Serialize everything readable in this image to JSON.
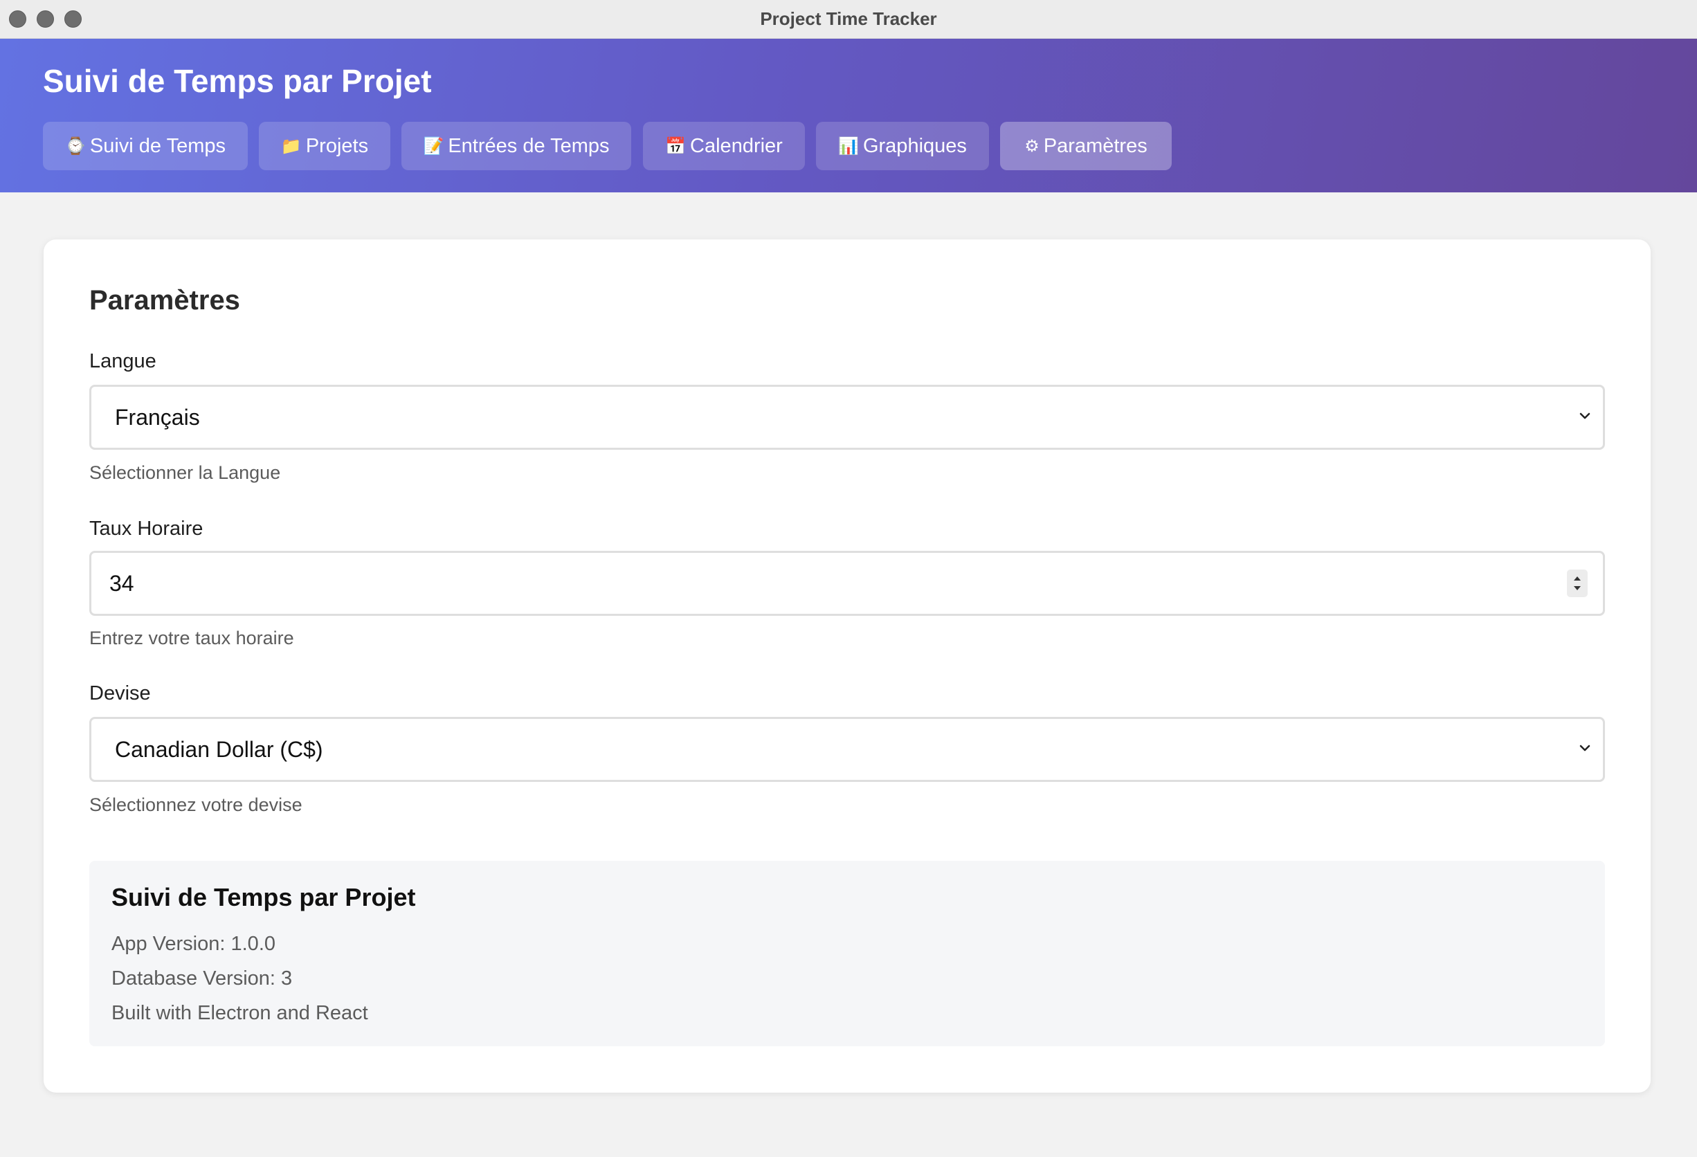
{
  "window": {
    "title": "Project Time Tracker"
  },
  "header": {
    "title": "Suivi de Temps par Projet",
    "nav": [
      {
        "icon": "⌚",
        "icon_name": "stopwatch-icon",
        "label": "Suivi de Temps",
        "active": false
      },
      {
        "icon": "📁",
        "icon_name": "folder-icon",
        "label": "Projets",
        "active": false
      },
      {
        "icon": "📝",
        "icon_name": "memo-icon",
        "label": "Entrées de Temps",
        "active": false
      },
      {
        "icon": "📅",
        "icon_name": "calendar-icon",
        "label": "Calendrier",
        "active": false
      },
      {
        "icon": "📊",
        "icon_name": "bar-chart-icon",
        "label": "Graphiques",
        "active": false
      },
      {
        "icon": "⚙",
        "icon_name": "gear-icon",
        "label": "Paramètres",
        "active": true
      }
    ]
  },
  "settings": {
    "title": "Paramètres",
    "language": {
      "label": "Langue",
      "value": "Français",
      "help": "Sélectionner la Langue"
    },
    "hourly_rate": {
      "label": "Taux Horaire",
      "value": "34",
      "help": "Entrez votre taux horaire"
    },
    "currency": {
      "label": "Devise",
      "value": "Canadian Dollar (C$)",
      "help": "Sélectionnez votre devise"
    }
  },
  "about": {
    "title": "Suivi de Temps par Projet",
    "app_version": "App Version: 1.0.0",
    "db_version": "Database Version: 3",
    "built_with": "Built with Electron and React"
  },
  "colors": {
    "header_gradient_start": "#6372e2",
    "header_gradient_end": "#64479c",
    "background": "#f2f2f2",
    "card": "#ffffff",
    "info_box": "#f5f6f8"
  }
}
